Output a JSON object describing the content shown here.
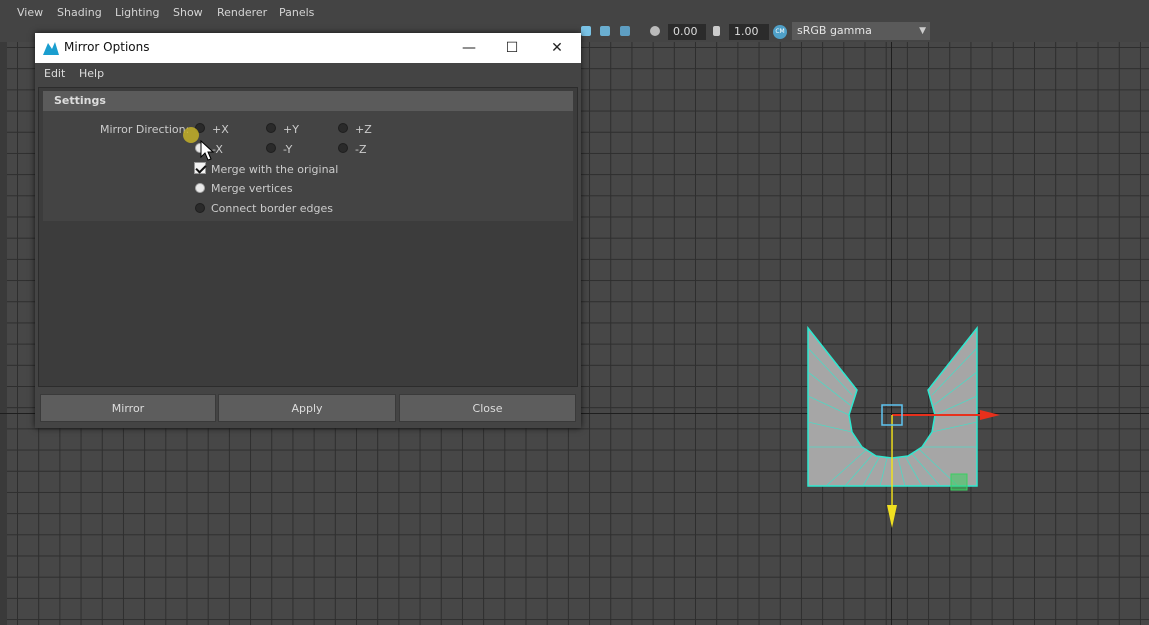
{
  "menubar": {
    "items": [
      "View",
      "Shading",
      "Lighting",
      "Show",
      "Renderer",
      "Panels"
    ]
  },
  "toolbar": {
    "exposure": "0.00",
    "gamma_value": "1.00",
    "colorspace": "sRGB gamma",
    "cm_badge": "CM"
  },
  "dialog": {
    "title": "Mirror Options",
    "minimize": "—",
    "maximize": "☐",
    "close": "✕",
    "menu": [
      "Edit",
      "Help"
    ],
    "section_title": "Settings",
    "mirror_direction_label": "Mirror Direction:",
    "directions": [
      "+X",
      "+Y",
      "+Z",
      "-X",
      "-Y",
      "-Z"
    ],
    "selected_direction": "-X",
    "merge_with_original_label": "Merge with the original",
    "merge_with_original_checked": true,
    "merge_vertices_label": "Merge vertices",
    "connect_border_edges_label": "Connect border edges",
    "selected_merge_option": "Merge vertices",
    "buttons": {
      "mirror": "Mirror",
      "apply": "Apply",
      "close": "Close"
    }
  },
  "colors": {
    "accent": "#4fb8e6",
    "wireframe": "#2ee8d0",
    "x_axis": "#e8301c",
    "y_axis": "#f0e020",
    "cursor_highlight": "#c4b028"
  }
}
